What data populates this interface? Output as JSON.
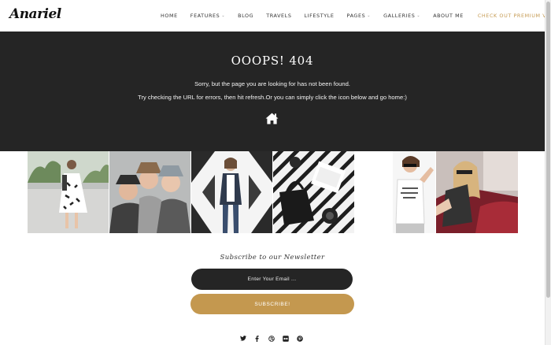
{
  "header": {
    "logo": "Anariel",
    "nav": [
      {
        "label": "HOME",
        "dropdown": false
      },
      {
        "label": "FEATURES",
        "dropdown": true
      },
      {
        "label": "BLOG",
        "dropdown": false
      },
      {
        "label": "TRAVELS",
        "dropdown": false
      },
      {
        "label": "LIFESTYLE",
        "dropdown": false
      },
      {
        "label": "PAGES",
        "dropdown": true
      },
      {
        "label": "GALLERIES",
        "dropdown": true
      },
      {
        "label": "ABOUT ME",
        "dropdown": false
      }
    ],
    "premium_link": "CHECK OUT PREMIUM VERSION"
  },
  "error": {
    "title": "OOOPS! 404",
    "line1": "Sorry, but the page you are looking for has not been found.",
    "line2": "Try checking the URL for errors, then hit refresh.Or you can simply click the icon below and go home:)",
    "home_icon": "home-icon"
  },
  "photos": [
    {
      "icon": "photo-woman-white-dress"
    },
    {
      "icon": "photo-three-women-hats"
    },
    {
      "icon": "photo-woman-geometric-wall"
    },
    {
      "icon": "photo-flatlay-handbag-notebook"
    },
    {
      "icon": "photo-woman-sunglasses-shirt"
    },
    {
      "icon": "photo-woman-in-car"
    }
  ],
  "newsletter": {
    "title": "Subscribe to our Newsletter",
    "email_placeholder": "Enter Your Email ...",
    "subscribe_label": "SUBSCRIBE!"
  },
  "social": [
    "twitter-icon",
    "facebook-icon",
    "dribbble-icon",
    "flickr-icon",
    "pinterest-icon"
  ],
  "colors": {
    "accent": "#c4984f",
    "dark": "#252525",
    "premium_link": "#c59a52"
  }
}
